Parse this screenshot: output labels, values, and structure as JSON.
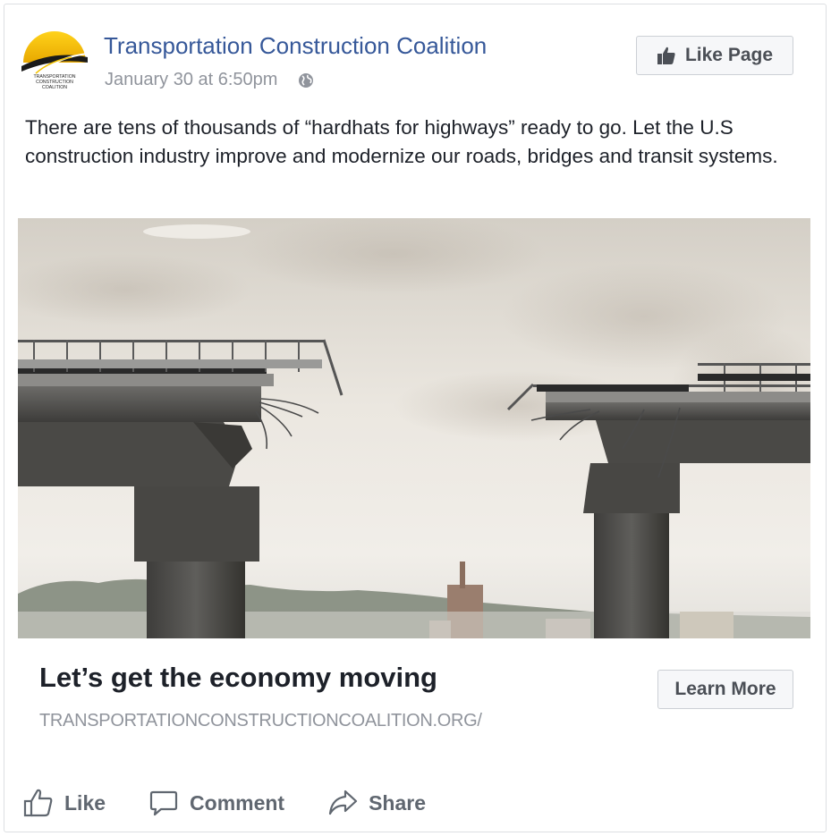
{
  "post": {
    "page_name": "Transportation Construction Coalition",
    "timestamp": "January 30 at 6:50pm",
    "privacy_icon": "globe-icon",
    "text": "There are tens of thousands of “hardhats for highways” ready to go. Let the U.S construction industry improve and modernize our roads, bridges and transit systems.",
    "logo": {
      "text_lines": [
        "TRANSPORTATION",
        "CONSTRUCTION",
        "COALITION"
      ],
      "accent": "#f2c200"
    }
  },
  "header": {
    "like_page_label": "Like Page"
  },
  "link_preview": {
    "title": "Let’s get the economy moving",
    "domain": "TRANSPORTATIONCONSTRUCTIONCOALITION.ORG/",
    "cta_label": "Learn More",
    "image": "broken-bridge-photo"
  },
  "actions": [
    {
      "label": "Like",
      "icon": "thumbs-up-icon"
    },
    {
      "label": "Comment",
      "icon": "comment-icon"
    },
    {
      "label": "Share",
      "icon": "share-icon"
    }
  ],
  "colors": {
    "link_blue": "#365899",
    "meta_gray": "#90949c",
    "text": "#1d2129",
    "button_bg": "#f6f7f9"
  }
}
